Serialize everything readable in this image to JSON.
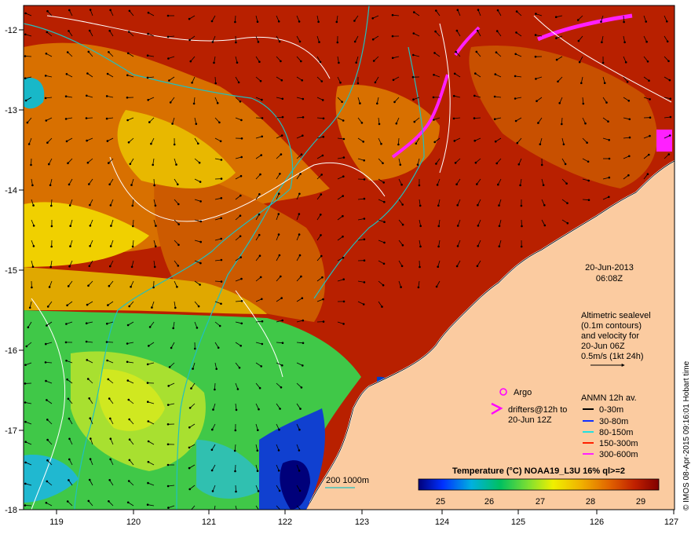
{
  "map": {
    "date": "20-Jun-2013",
    "time": "06:08Z",
    "altimetry_note": [
      "Altimetric sealevel",
      "(0.1m contours)",
      "and velocity for",
      "20-Jun 06Z",
      "0.5m/s (1kt 24h)"
    ],
    "argo_label": "Argo",
    "drifters_label": [
      "drifters@12h to",
      "20-Jun 12Z"
    ],
    "anmn_title": "ANMN 12h av.",
    "anmn_legend": [
      {
        "label": "0-30m",
        "color": "#000000"
      },
      {
        "label": "30-80m",
        "color": "#1030ff"
      },
      {
        "label": "80-150m",
        "color": "#20e0e0"
      },
      {
        "label": "150-300m",
        "color": "#ff2000"
      },
      {
        "label": "300-600m",
        "color": "#ff20ff"
      }
    ],
    "isobath_label": "200  1000m",
    "colorbar_title": "Temperature (°C) NOAA19_L3U 16% ql>=2",
    "colorbar_ticks": [
      "25",
      "26",
      "27",
      "28",
      "29"
    ],
    "credit": "© IMOS 08-Apr-2015 09:16:01 Hobart time",
    "lon_ticks": [
      "119",
      "120",
      "121",
      "122",
      "123",
      "124",
      "125",
      "126",
      "127"
    ],
    "lat_ticks": [
      "-12",
      "-13",
      "-14",
      "-15",
      "-16",
      "-17",
      "-18"
    ],
    "colors": {
      "land": "#fbcba0",
      "warm": "#a81000",
      "mid": "#d86a00",
      "cool": "#3cd040",
      "cold": "#00007a",
      "isobath": "#20c0c0",
      "marker": "#ff00ff"
    }
  }
}
